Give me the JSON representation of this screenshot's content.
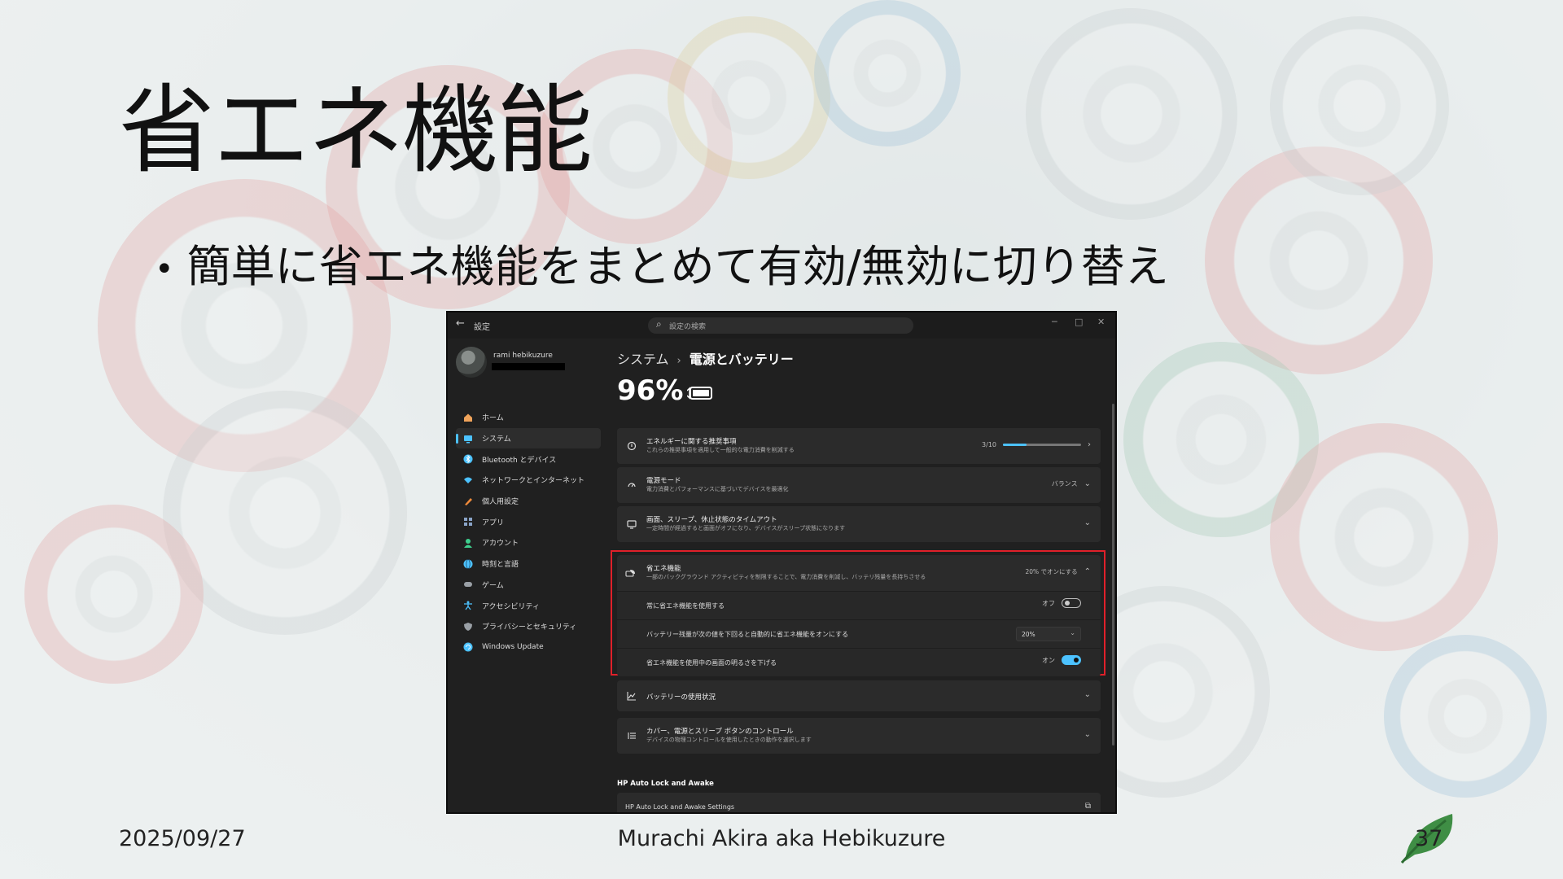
{
  "slide": {
    "title": "省エネ機能",
    "bullet": "簡単に省エネ機能をまとめて有効/無効に切り替え",
    "footer_date": "2025/09/27",
    "footer_author": "Murachi Akira aka Hebikuzure",
    "page_number": "37"
  },
  "screenshot": {
    "titlebar": {
      "app_name": "設定",
      "search_placeholder": "設定の検索",
      "minimize": "─",
      "maximize": "□",
      "close": "✕"
    },
    "user": {
      "name": "rami hebikuzure"
    },
    "sidebar": [
      {
        "label": "ホーム",
        "icon": "home-icon",
        "color": "#f0a35a"
      },
      {
        "label": "システム",
        "icon": "system-icon",
        "color": "#4cc2ff",
        "active": true
      },
      {
        "label": "Bluetooth とデバイス",
        "icon": "bluetooth-icon",
        "color": "#4cc2ff"
      },
      {
        "label": "ネットワークとインターネット",
        "icon": "network-icon",
        "color": "#4cc2ff"
      },
      {
        "label": "個人用設定",
        "icon": "brush-icon",
        "color": "#f08a3a"
      },
      {
        "label": "アプリ",
        "icon": "apps-icon",
        "color": "#8aa4c8"
      },
      {
        "label": "アカウント",
        "icon": "account-icon",
        "color": "#3ecf8e"
      },
      {
        "label": "時刻と言語",
        "icon": "globe-icon",
        "color": "#4cc2ff"
      },
      {
        "label": "ゲーム",
        "icon": "game-icon",
        "color": "#9aa0a6"
      },
      {
        "label": "アクセシビリティ",
        "icon": "accessibility-icon",
        "color": "#4cc2ff"
      },
      {
        "label": "プライバシーとセキュリティ",
        "icon": "shield-icon",
        "color": "#9aa0a6"
      },
      {
        "label": "Windows Update",
        "icon": "update-icon",
        "color": "#4cc2ff"
      }
    ],
    "breadcrumb": {
      "parent": "システム",
      "separator": "›",
      "current": "電源とバッテリー"
    },
    "battery_percent": "96%",
    "cards": [
      {
        "title": "エネルギーに関する推奨事項",
        "subtitle": "これらの推奨事項を適用して一般的な電力消費を削減する",
        "right_text": "3/10",
        "progress": 0.3,
        "control": "chevron-right"
      },
      {
        "title": "電源モード",
        "subtitle": "電力消費とパフォーマンスに基づいてデバイスを最適化",
        "right_text": "バランス",
        "control": "chevron-down"
      },
      {
        "title": "画面、スリープ、休止状態のタイムアウト",
        "subtitle": "一定時間が経過すると画面がオフになり、デバイスがスリープ状態になります",
        "right_text": "",
        "control": "chevron-down"
      }
    ],
    "energy_saver": {
      "title": "省エネ機能",
      "subtitle": "一部のバックグラウンド アクティビティを制限することで、電力消費を削減し、バッテリ残量を長持ちさせる",
      "status": "20% でオンにする",
      "rows": [
        {
          "label": "常に省エネ機能を使用する",
          "value": "オフ",
          "on": false
        },
        {
          "label": "バッテリー残量が次の値を下回ると自動的に省エネ機能をオンにする",
          "value": "20%",
          "type": "select"
        },
        {
          "label": "省エネ機能を使用中の画面の明るさを下げる",
          "value": "オン",
          "on": true
        }
      ]
    },
    "cards_after": [
      {
        "title": "バッテリーの使用状況",
        "subtitle": "",
        "control": "chevron-down"
      },
      {
        "title": "カバー、電源とスリープ ボタンのコントロール",
        "subtitle": "デバイスの物理コントロールを使用したときの動作を選択します",
        "control": "chevron-down"
      }
    ],
    "section": {
      "title": "HP Auto Lock and Awake",
      "card_title": "HP Auto Lock and Awake Settings"
    }
  }
}
